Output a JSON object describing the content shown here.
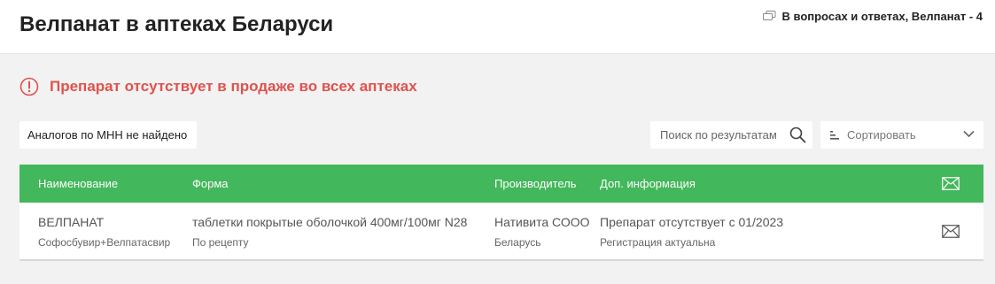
{
  "header": {
    "title": "Велпанат в аптеках Беларуси",
    "qa_link": "В вопросах и ответах, Велпанат - 4",
    "qa_icon": "chat-bubbles-icon"
  },
  "alert": {
    "icon": "exclamation-circle-icon",
    "text": "Препарат отсутствует в продаже во всех аптеках",
    "color": "#e0524d"
  },
  "toolbar": {
    "analogs_label": "Аналогов по МНН не найдено",
    "search_placeholder": "Поиск по результатам",
    "search_icon": "search-icon",
    "sort_label": "Сортировать",
    "sort_icon": "sort-icon",
    "sort_chevron": "chevron-down-icon"
  },
  "table": {
    "header_color": "#43b75b",
    "columns": [
      "Наименование",
      "Форма",
      "Производитель",
      "Доп. информация"
    ],
    "header_icon": "envelope-icon",
    "rows": [
      {
        "name": "ВЕЛПАНАТ",
        "inn": "Софосбувир+Велпатасвир",
        "form": "таблетки покрытые оболочкой 400мг/100мг N28",
        "dispensing": "По рецепту",
        "manufacturer": "Нативита СООО",
        "country": "Беларусь",
        "info": "Препарат отсутствует с 01/2023",
        "registration": "Регистрация актуальна",
        "action_icon": "envelope-icon"
      }
    ]
  }
}
